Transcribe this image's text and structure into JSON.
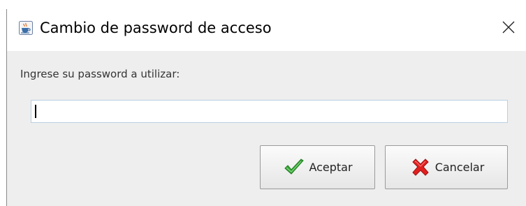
{
  "window": {
    "title": "Cambio de password de acceso",
    "app_icon": "java-cup-icon",
    "close_icon": "close-icon"
  },
  "form": {
    "prompt": "Ingrese su password a utilizar:",
    "password_value": ""
  },
  "buttons": {
    "accept": {
      "label": "Aceptar",
      "icon": "green-check-icon"
    },
    "cancel": {
      "label": "Cancelar",
      "icon": "red-x-icon"
    }
  },
  "colors": {
    "content_background": "#eeeeee",
    "field_border": "#b8cfe5",
    "accept_icon": "#3aa53a",
    "cancel_icon": "#e02020"
  }
}
